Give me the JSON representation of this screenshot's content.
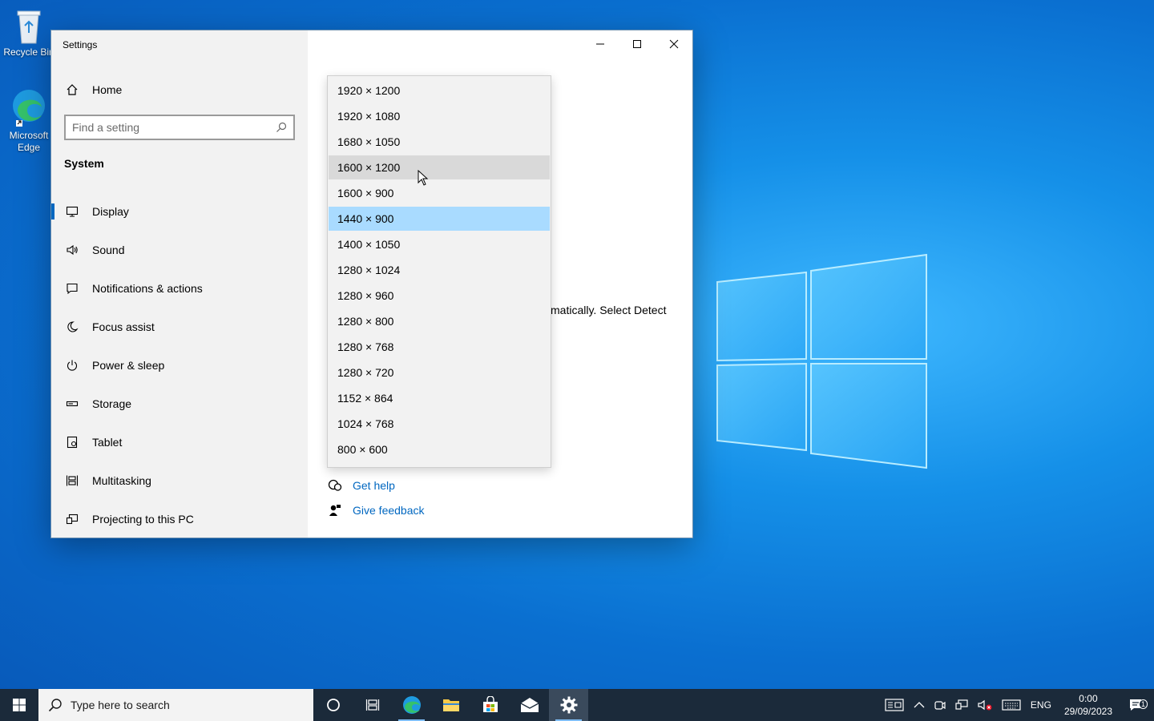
{
  "desktop": {
    "icons": [
      {
        "label": "Recycle Bin",
        "icon": "recycle-bin-icon"
      },
      {
        "label": "Microsoft Edge",
        "icon": "edge-icon"
      }
    ]
  },
  "window": {
    "title": "Settings",
    "controls": {
      "minimize": "minimize-icon",
      "maximize": "maximize-icon",
      "close": "close-icon"
    }
  },
  "sidebar": {
    "home_label": "Home",
    "search_placeholder": "Find a setting",
    "section_title": "System",
    "items": [
      {
        "label": "Display",
        "icon": "monitor-icon",
        "active": true
      },
      {
        "label": "Sound",
        "icon": "speaker-icon"
      },
      {
        "label": "Notifications & actions",
        "icon": "notification-icon"
      },
      {
        "label": "Focus assist",
        "icon": "moon-icon"
      },
      {
        "label": "Power & sleep",
        "icon": "power-icon"
      },
      {
        "label": "Storage",
        "icon": "storage-icon"
      },
      {
        "label": "Tablet",
        "icon": "tablet-icon"
      },
      {
        "label": "Multitasking",
        "icon": "multitasking-icon"
      },
      {
        "label": "Projecting to this PC",
        "icon": "projecting-icon"
      }
    ]
  },
  "content": {
    "partial_text": "matically. Select Detect",
    "resolution_dropdown": {
      "options": [
        "1920 × 1200",
        "1920 × 1080",
        "1680 × 1050",
        "1600 × 1200",
        "1600 × 900",
        "1440 × 900",
        "1400 × 1050",
        "1280 × 1024",
        "1280 × 960",
        "1280 × 800",
        "1280 × 768",
        "1280 × 720",
        "1152 × 864",
        "1024 × 768",
        "800 × 600"
      ],
      "selected": "1440 × 900",
      "hovered": "1600 × 1200"
    },
    "links": {
      "get_help": "Get help",
      "give_feedback": "Give feedback"
    }
  },
  "taskbar": {
    "search_placeholder": "Type here to search",
    "apps": [
      "cortana-icon",
      "task-view-icon",
      "edge-icon",
      "file-explorer-icon",
      "store-icon",
      "mail-icon",
      "settings-icon"
    ],
    "tray": {
      "language": "ENG",
      "time": "0:00",
      "date": "29/09/2023",
      "notification_count": "1"
    }
  },
  "colors": {
    "accent": "#0067c0",
    "selected": "#a9dbff",
    "taskbar": "#1b2a3a"
  }
}
